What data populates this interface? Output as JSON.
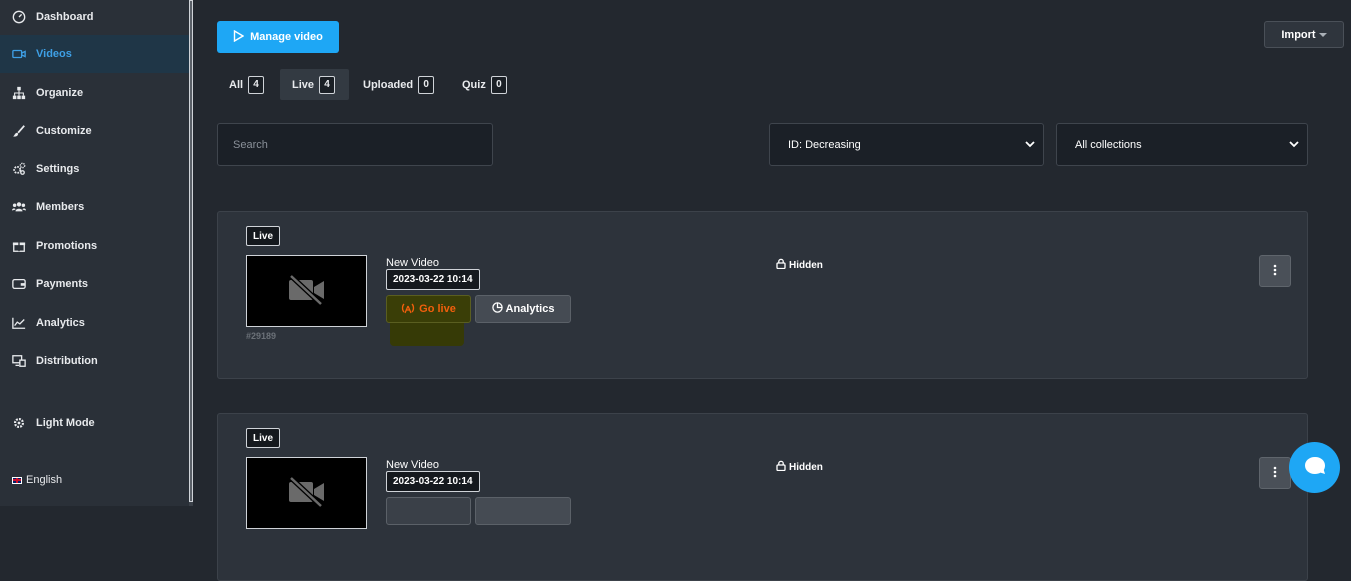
{
  "sidebar": {
    "items": [
      {
        "label": "Dashboard",
        "icon": "dashboard-icon"
      },
      {
        "label": "Videos",
        "icon": "video-camera-icon",
        "active": true
      },
      {
        "label": "Organize",
        "icon": "sitemap-icon"
      },
      {
        "label": "Customize",
        "icon": "brush-icon"
      },
      {
        "label": "Settings",
        "icon": "gears-icon"
      },
      {
        "label": "Members",
        "icon": "users-icon"
      },
      {
        "label": "Promotions",
        "icon": "gift-icon"
      },
      {
        "label": "Payments",
        "icon": "wallet-icon"
      },
      {
        "label": "Analytics",
        "icon": "line-chart-icon"
      },
      {
        "label": "Distribution",
        "icon": "distribution-icon"
      }
    ],
    "theme_toggle": "Light Mode",
    "language": "English"
  },
  "toolbar": {
    "manage_label": "Manage video",
    "import_label": "Import"
  },
  "tabs": [
    {
      "label": "All",
      "count": "4"
    },
    {
      "label": "Live",
      "count": "4",
      "active": true
    },
    {
      "label": "Uploaded",
      "count": "0"
    },
    {
      "label": "Quiz",
      "count": "0"
    }
  ],
  "filters": {
    "search_placeholder": "Search",
    "sort_value": "ID: Decreasing",
    "collection_value": "All collections"
  },
  "videos": [
    {
      "badge": "Live",
      "title": "New Video",
      "date": "2023-03-22 10:14",
      "id": "#29189",
      "status": "Hidden",
      "go_live_label": "Go live",
      "analytics_label": "Analytics"
    },
    {
      "badge": "Live",
      "title": "New Video",
      "date": "2023-03-22 10:14",
      "id": "",
      "status": "Hidden",
      "go_live_label": "",
      "analytics_label": ""
    }
  ],
  "colors": {
    "accent": "#1ea7f5",
    "go_live_text": "#f25f0c",
    "background": "#23282f",
    "sidebar": "#2a3038"
  }
}
